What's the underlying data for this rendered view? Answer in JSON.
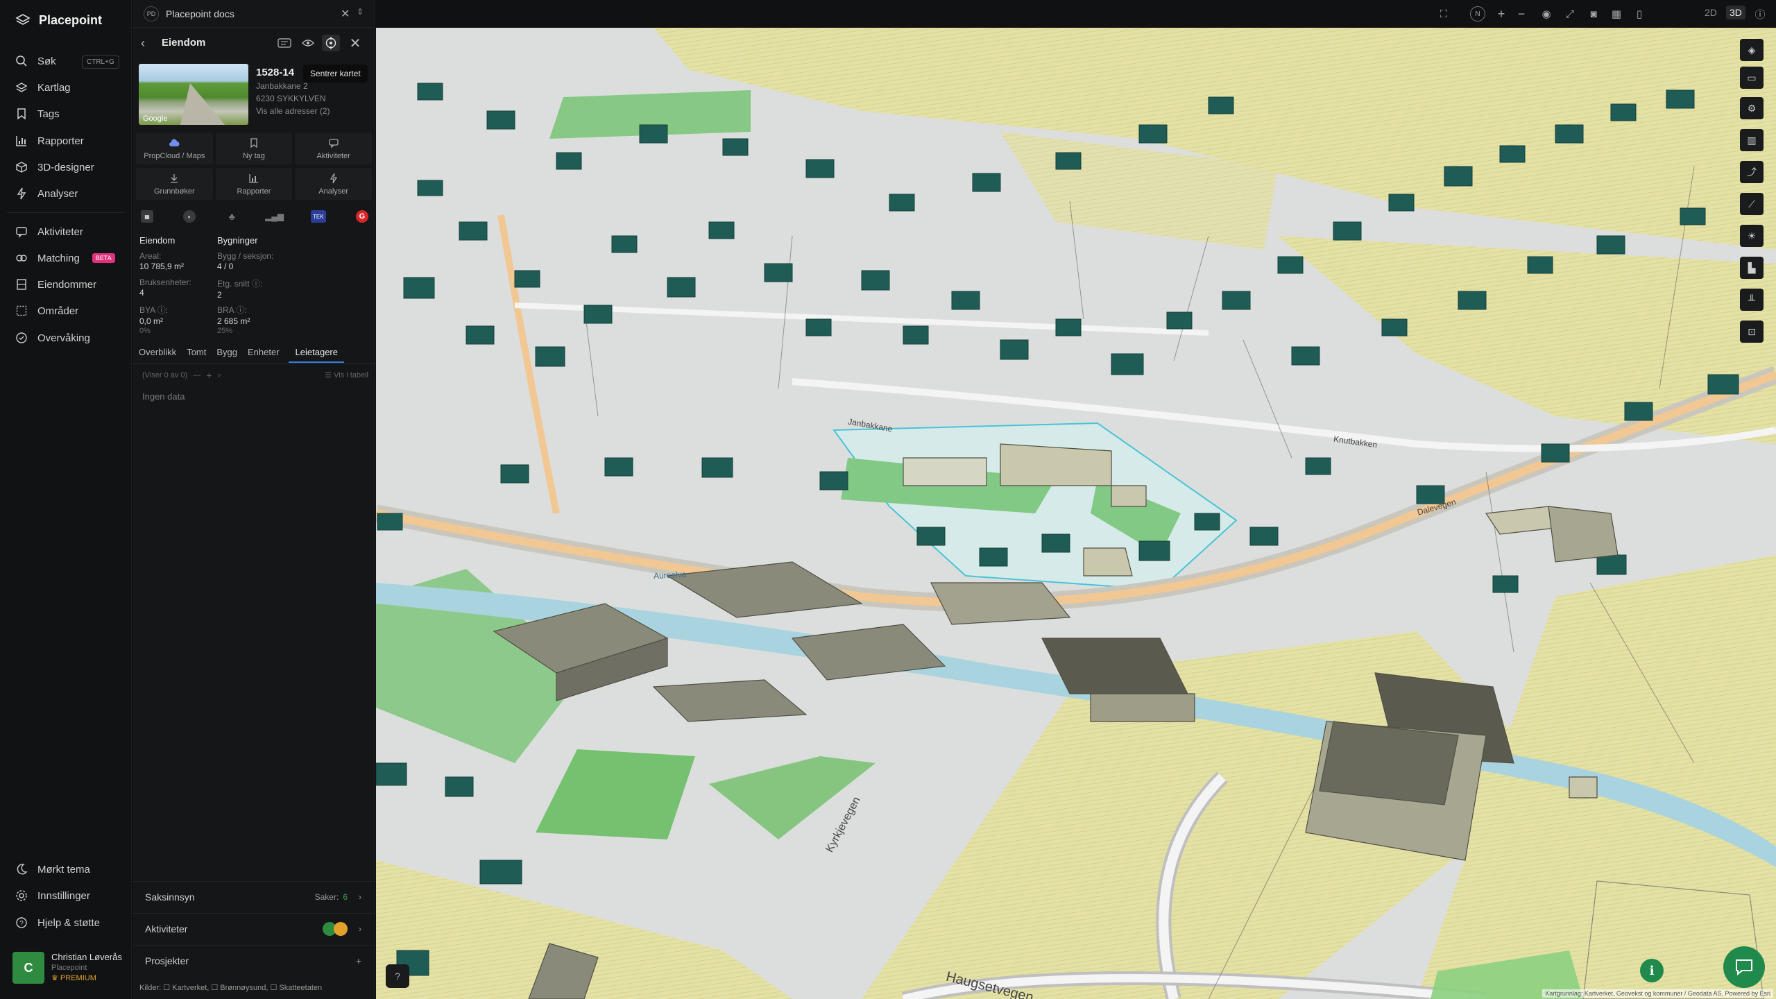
{
  "app": {
    "name": "Placepoint"
  },
  "nav": {
    "search": "Søk",
    "search_shortcut": "CTRL+G",
    "items_top": [
      "Kartlag",
      "Tags",
      "Rapporter",
      "3D-designer",
      "Analyser"
    ],
    "items_mid": [
      "Aktiviteter",
      "Matching",
      "Eiendommer",
      "Områder",
      "Overvåking"
    ],
    "matching_badge": "BETA",
    "items_bottom": [
      "Mørkt tema",
      "Innstillinger",
      "Hjelp & støtte"
    ],
    "user": {
      "initial": "C",
      "name": "Christian Løverås",
      "org": "Placepoint",
      "tier": "PREMIUM"
    }
  },
  "panel": {
    "workspace_badge": "PD",
    "workspace_title": "Placepoint docs",
    "header_title": "Eiendom",
    "tooltip": "Sentrer kartet",
    "photo_label": "Google",
    "property": {
      "id": "1528-14",
      "street": "Janbakkane 2",
      "postal": "6230 SYKKYLVEN",
      "addresses_link": "Vis alle adresser (2)"
    },
    "actions_row1": [
      "PropCloud / Maps",
      "Ny tag",
      "Aktiviteter"
    ],
    "actions_row2": [
      "Grunnbøker",
      "Rapporter",
      "Analyser"
    ],
    "source_badges": {
      "tek": "TEK",
      "g": "G"
    },
    "facts": {
      "col1_title": "Eiendom",
      "col2_title": "Bygninger",
      "areal_label": "Areal:",
      "areal_value": "10 785,9 m²",
      "bygg_label": "Bygg / seksjon:",
      "bygg_value": "4 / 0",
      "bruk_label": "Bruksenheter:",
      "bruk_value": "4",
      "etg_label": "Etg. snitt ⓘ:",
      "etg_value": "2",
      "bya_label": "BYA ⓘ:",
      "bya_value": "0,0 m²",
      "bya_pct": "0%",
      "bra_label": "BRA ⓘ:",
      "bra_value": "2 685 m²",
      "bra_pct": "25%"
    },
    "tabs": [
      "Overblikk",
      "Tomt",
      "Bygg",
      "Enheter",
      "Leietagere"
    ],
    "active_tab": "Leietagere",
    "list_count": "(Viser 0 av 0)",
    "list_table": "Vis i tabell",
    "no_data": "Ingen data",
    "sections": {
      "saksinnsyn": "Saksinnsyn",
      "saker_label": "Saker:",
      "saker_count": "6",
      "aktiviteter": "Aktiviteter",
      "prosjekter": "Prosjekter",
      "prosjekter_add": "+"
    },
    "kilder": "Kilder: ☐ Kartverket, ☐ Brønnøysund, ☐ Skatteetaten"
  },
  "topbar": {
    "mode_2d": "2D",
    "mode_3d": "3D",
    "compass": "N"
  },
  "map": {
    "road_labels": [
      "Janbakkane",
      "Knutbakken",
      "Dalevegen",
      "Aureelva",
      "Kyrkjevegen",
      "Haugsetvegen"
    ],
    "attribution": "Kartgrunnlag: Kartverket, Geovekst og kommuner / Geodata AS, Powered by Esri",
    "colors": {
      "building_green": "#1f5c55",
      "plot_outline": "#49c3d6",
      "field": "#e6e2a0",
      "river": "#a9d4df"
    }
  }
}
